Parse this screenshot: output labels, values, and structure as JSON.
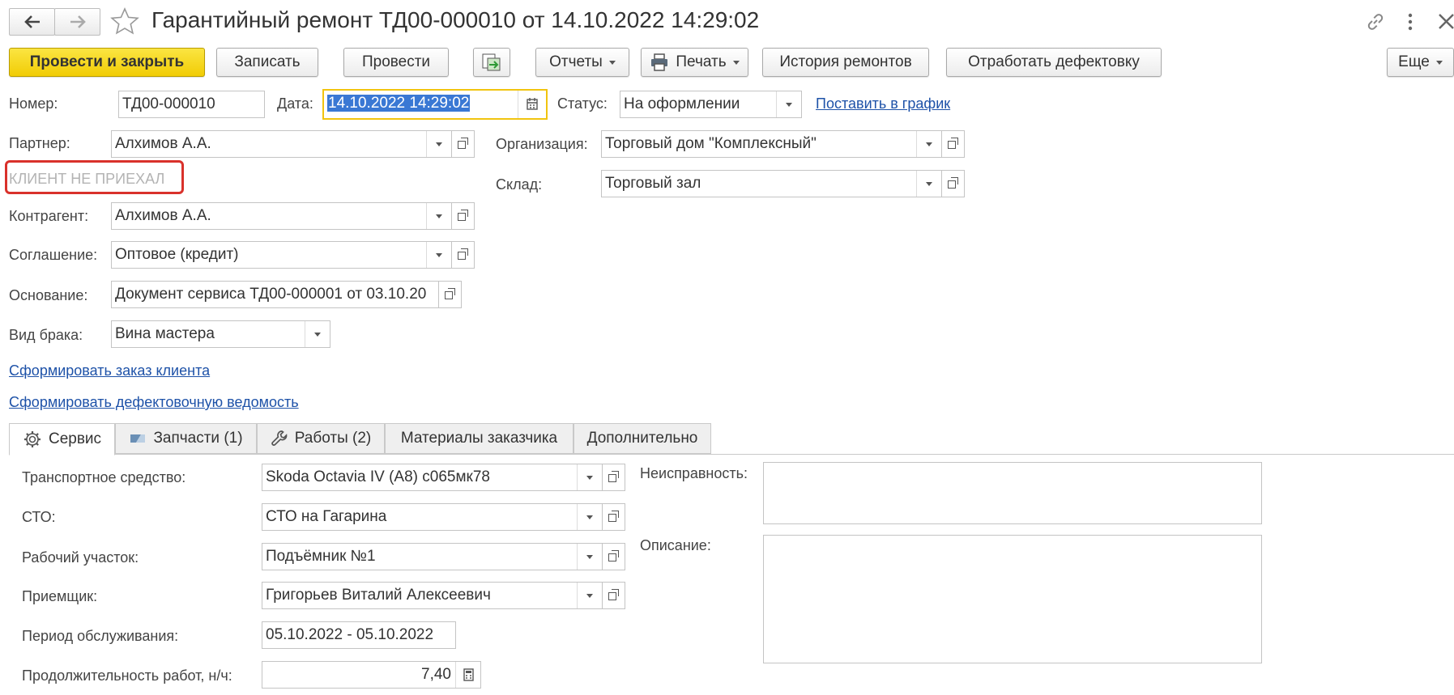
{
  "window": {
    "title": "Гарантийный ремонт ТД00-000010 от 14.10.2022 14:29:02"
  },
  "toolbar": {
    "post_close": "Провести и закрыть",
    "save": "Записать",
    "post": "Провести",
    "reports": "Отчеты",
    "print": "Печать",
    "repair_history": "История ремонтов",
    "process_defects": "Отработать дефектовку",
    "more": "Еще"
  },
  "header": {
    "number_label": "Номер:",
    "number_value": "ТД00-000010",
    "date_label": "Дата:",
    "date_value": "14.10.2022 14:29:02",
    "status_label": "Статус:",
    "status_value": "На оформлении",
    "schedule_link": "Поставить в график"
  },
  "fields": {
    "partner_label": "Партнер:",
    "partner_value": "Алхимов А.А.",
    "client_note": "КЛИЕНТ НЕ ПРИЕХАЛ",
    "counterparty_label": "Контрагент:",
    "counterparty_value": "Алхимов А.А.",
    "agreement_label": "Соглашение:",
    "agreement_value": "Оптовое (кредит)",
    "basis_label": "Основание:",
    "basis_value": "Документ сервиса ТД00-000001 от 03.10.20",
    "defect_type_label": "Вид брака:",
    "defect_type_value": "Вина мастера",
    "org_label": "Организация:",
    "org_value": "Торговый дом \"Комплексный\"",
    "warehouse_label": "Склад:",
    "warehouse_value": "Торговый зал"
  },
  "links": {
    "create_order": "Сформировать заказ клиента",
    "create_defect_sheet": "Сформировать дефектовочную ведомость"
  },
  "tabs": [
    {
      "label": "Сервис"
    },
    {
      "label": "Запчасти (1)"
    },
    {
      "label": "Работы (2)"
    },
    {
      "label": "Материалы заказчика"
    },
    {
      "label": "Дополнительно"
    }
  ],
  "service": {
    "vehicle_label": "Транспортное средство:",
    "vehicle_value": "Skoda Octavia IV (A8) с065мк78",
    "sto_label": "СТО:",
    "sto_value": "СТО на Гагарина",
    "workplace_label": "Рабочий участок:",
    "workplace_value": "Подъёмник №1",
    "receiver_label": "Приемщик:",
    "receiver_value": "Григорьев Виталий Алексеевич",
    "period_label": "Период обслуживания:",
    "period_value": "05.10.2022 - 05.10.2022",
    "duration_label": "Продолжительность работ, н/ч:",
    "duration_value": "7,40",
    "malfunction_label": "Неисправность:",
    "description_label": "Описание:"
  },
  "colors": {
    "primary_button": "#f1cc05",
    "link": "#1e52a8",
    "highlight_frame": "#d9312b",
    "date_selection": "#3a78d4"
  }
}
